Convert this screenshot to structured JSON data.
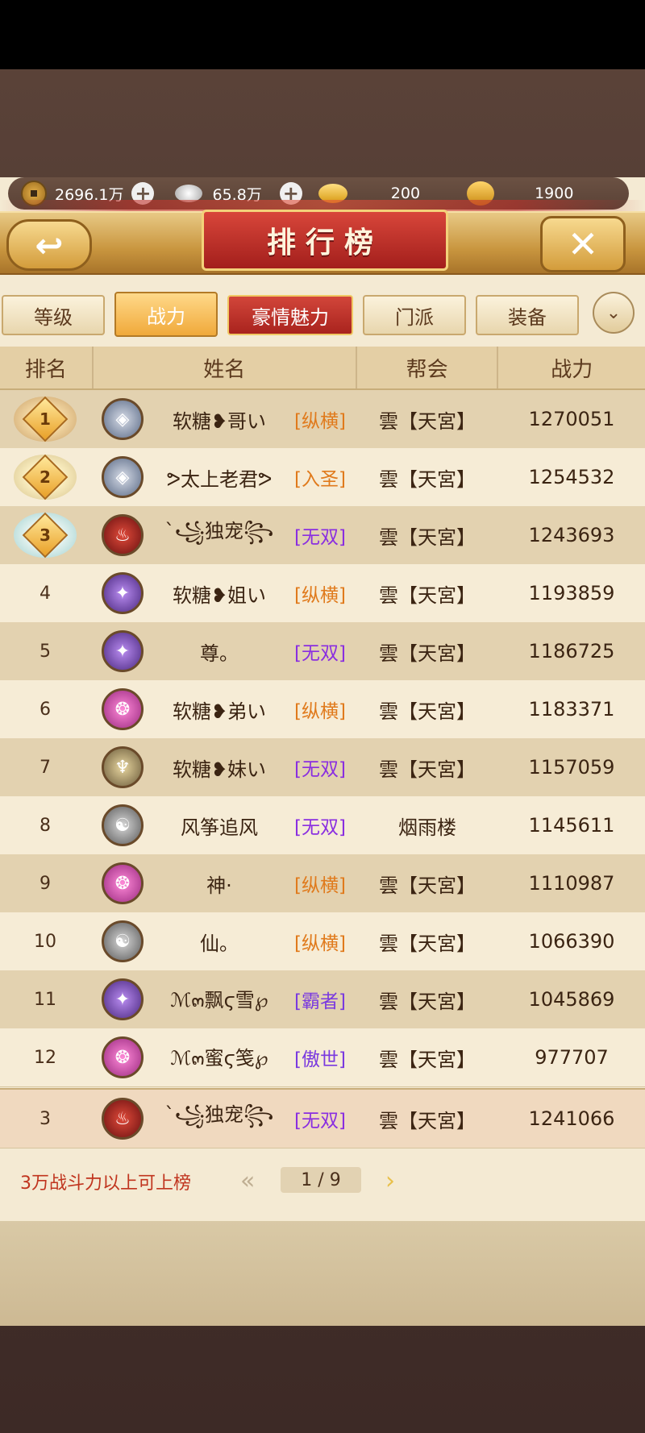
{
  "currency": {
    "copper": "2696.1万",
    "silver": "65.8万",
    "gold": "200",
    "bound_gold": "1900"
  },
  "title": "排行榜",
  "tabs": [
    {
      "label": "等级"
    },
    {
      "label": "战力"
    },
    {
      "label": "豪情魅力"
    },
    {
      "label": "门派"
    },
    {
      "label": "装备"
    }
  ],
  "columns": {
    "rank": "排名",
    "name": "姓名",
    "guild": "帮会",
    "power": "战力"
  },
  "rows": [
    {
      "rank": "1",
      "name": "软糖❥哥い",
      "tag": "[纵横]",
      "guild": "雲【天宮】",
      "power": "1270051"
    },
    {
      "rank": "2",
      "name": "ᕗ太上老君ᕗ",
      "tag": "[入圣]",
      "guild": "雲【天宮】",
      "power": "1254532"
    },
    {
      "rank": "3",
      "name": "ˋ꧁独宠꧂",
      "tag": "[无双]",
      "guild": "雲【天宮】",
      "power": "1243693"
    },
    {
      "rank": "4",
      "name": "软糖❥姐い",
      "tag": "[纵横]",
      "guild": "雲【天宮】",
      "power": "1193859"
    },
    {
      "rank": "5",
      "name": "尊。",
      "tag": "[无双]",
      "guild": "雲【天宮】",
      "power": "1186725"
    },
    {
      "rank": "6",
      "name": "软糖❥弟い",
      "tag": "[纵横]",
      "guild": "雲【天宮】",
      "power": "1183371"
    },
    {
      "rank": "7",
      "name": "软糖❥妹い",
      "tag": "[无双]",
      "guild": "雲【天宮】",
      "power": "1157059"
    },
    {
      "rank": "8",
      "name": "风筝追风",
      "tag": "[无双]",
      "guild": "烟雨楼",
      "power": "1145611"
    },
    {
      "rank": "9",
      "name": "神·",
      "tag": "[纵横]",
      "guild": "雲【天宮】",
      "power": "1110987"
    },
    {
      "rank": "10",
      "name": "仙。",
      "tag": "[纵横]",
      "guild": "雲【天宮】",
      "power": "1066390"
    },
    {
      "rank": "11",
      "name": "ℳ๓飘ϛ雪℘",
      "tag": "[霸者]",
      "guild": "雲【天宮】",
      "power": "1045869"
    },
    {
      "rank": "12",
      "name": "ℳ๓蜜ϛ笺℘",
      "tag": "[傲世]",
      "guild": "雲【天宮】",
      "power": "977707"
    }
  ],
  "my_row": {
    "rank": "3",
    "name": "ˋ꧁独宠꧂",
    "tag": "[无双]",
    "guild": "雲【天宮】",
    "power": "1241066"
  },
  "footer": {
    "tip": "3万战斗力以上可上榜",
    "page": "1 / 9"
  },
  "colors": {
    "tag_orange": "#e07a1c",
    "tag_purple": "#8a2ee0",
    "title_red": "#a31f1c",
    "panel": "#f4ead3"
  }
}
